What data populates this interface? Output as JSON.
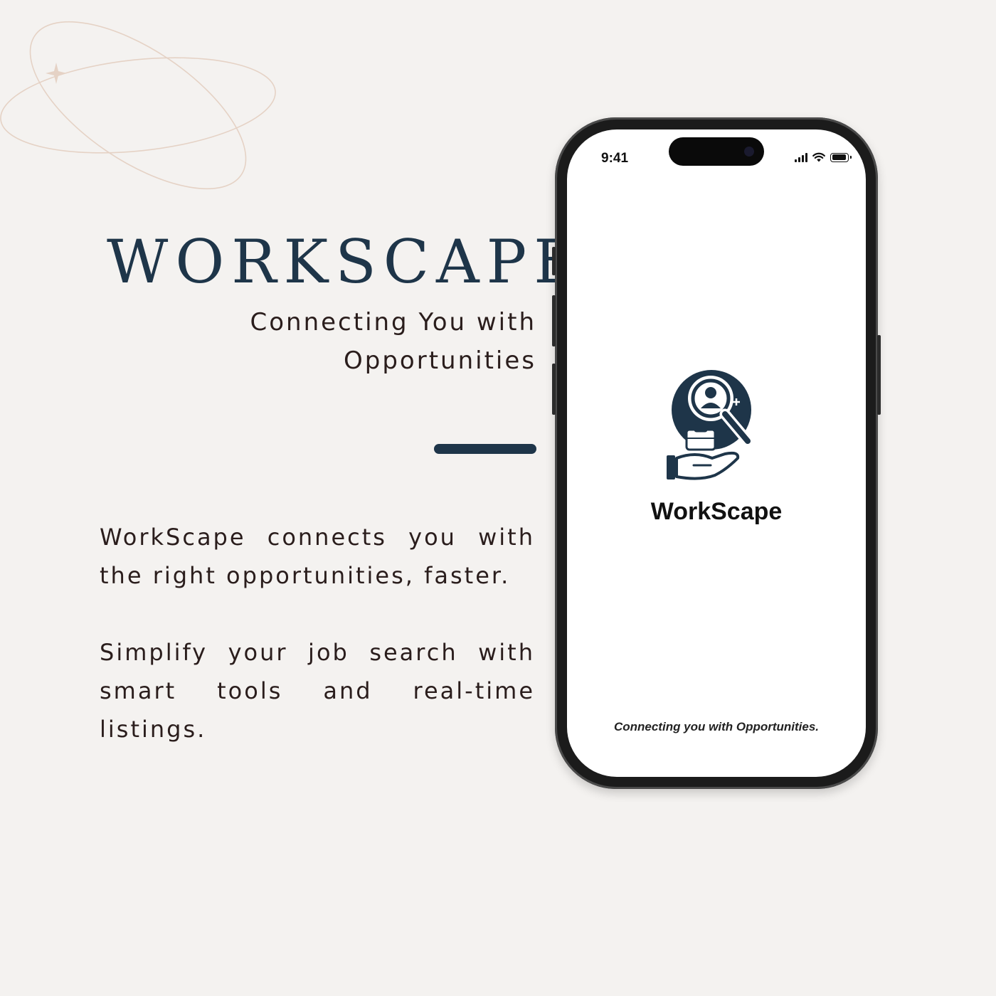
{
  "colors": {
    "background": "#f4f2f0",
    "navy": "#1e3549",
    "text": "#2a1d1c",
    "orbit": "#e5d2c5"
  },
  "hero": {
    "title": "WORKSCAPE",
    "tagline_line1": "Connecting You with",
    "tagline_line2": "Opportunities"
  },
  "description": {
    "paragraph1": "WorkScape connects you with the right opportunities, faster.",
    "paragraph2": "Simplify your job search with smart tools and real-time listings."
  },
  "phone": {
    "status_bar": {
      "time": "9:41",
      "icons": [
        "signal-icon",
        "wifi-icon",
        "battery-icon"
      ]
    },
    "splash": {
      "logo_icon": "job-search-logo-icon",
      "app_name": "WorkScape",
      "tagline": "Connecting you with Opportunities."
    }
  }
}
